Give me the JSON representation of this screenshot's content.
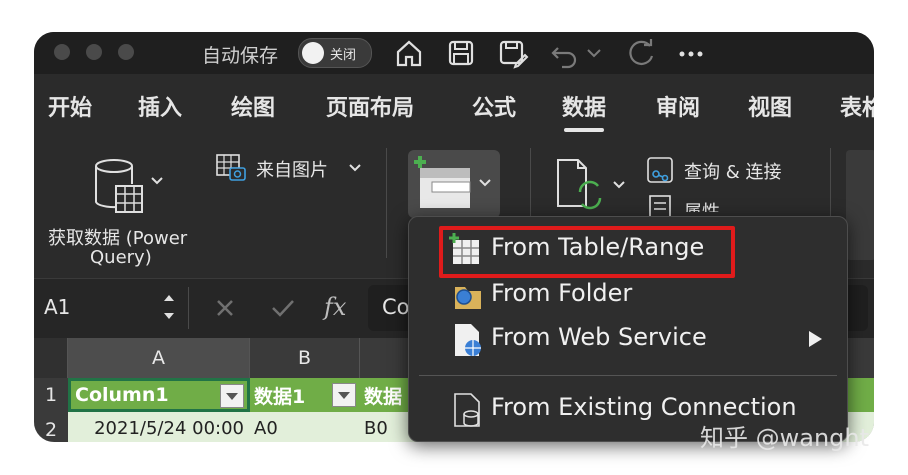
{
  "titlebar": {
    "autosave_label": "自动保存",
    "autosave_state": "关闭"
  },
  "tabs": [
    {
      "label": "开始"
    },
    {
      "label": "插入"
    },
    {
      "label": "绘图"
    },
    {
      "label": "页面布局"
    },
    {
      "label": "公式"
    },
    {
      "label": "数据"
    },
    {
      "label": "审阅"
    },
    {
      "label": "视图"
    },
    {
      "label": "表格"
    }
  ],
  "ribbon": {
    "get_data_line1": "获取数据 (Power",
    "get_data_line2": "Query)",
    "from_picture": "来自图片",
    "queries_connections": "查询 & 连接",
    "properties": "属性"
  },
  "formula_bar": {
    "name_box": "A1",
    "fx": "fx",
    "content": "Co"
  },
  "sheet": {
    "columns": [
      "A",
      "B"
    ],
    "rows": [
      {
        "num": "1",
        "a": "Column1",
        "b": "数据1",
        "c": "数据"
      },
      {
        "num": "2",
        "a": "2021/5/24 00:00",
        "b": "A0",
        "c": "B0"
      }
    ]
  },
  "menu": {
    "items": [
      {
        "label": "From Table/Range"
      },
      {
        "label": "From Folder"
      },
      {
        "label": "From Web Service"
      },
      {
        "label": "From Existing Connection"
      }
    ]
  },
  "watermark": "知乎 @wanght"
}
